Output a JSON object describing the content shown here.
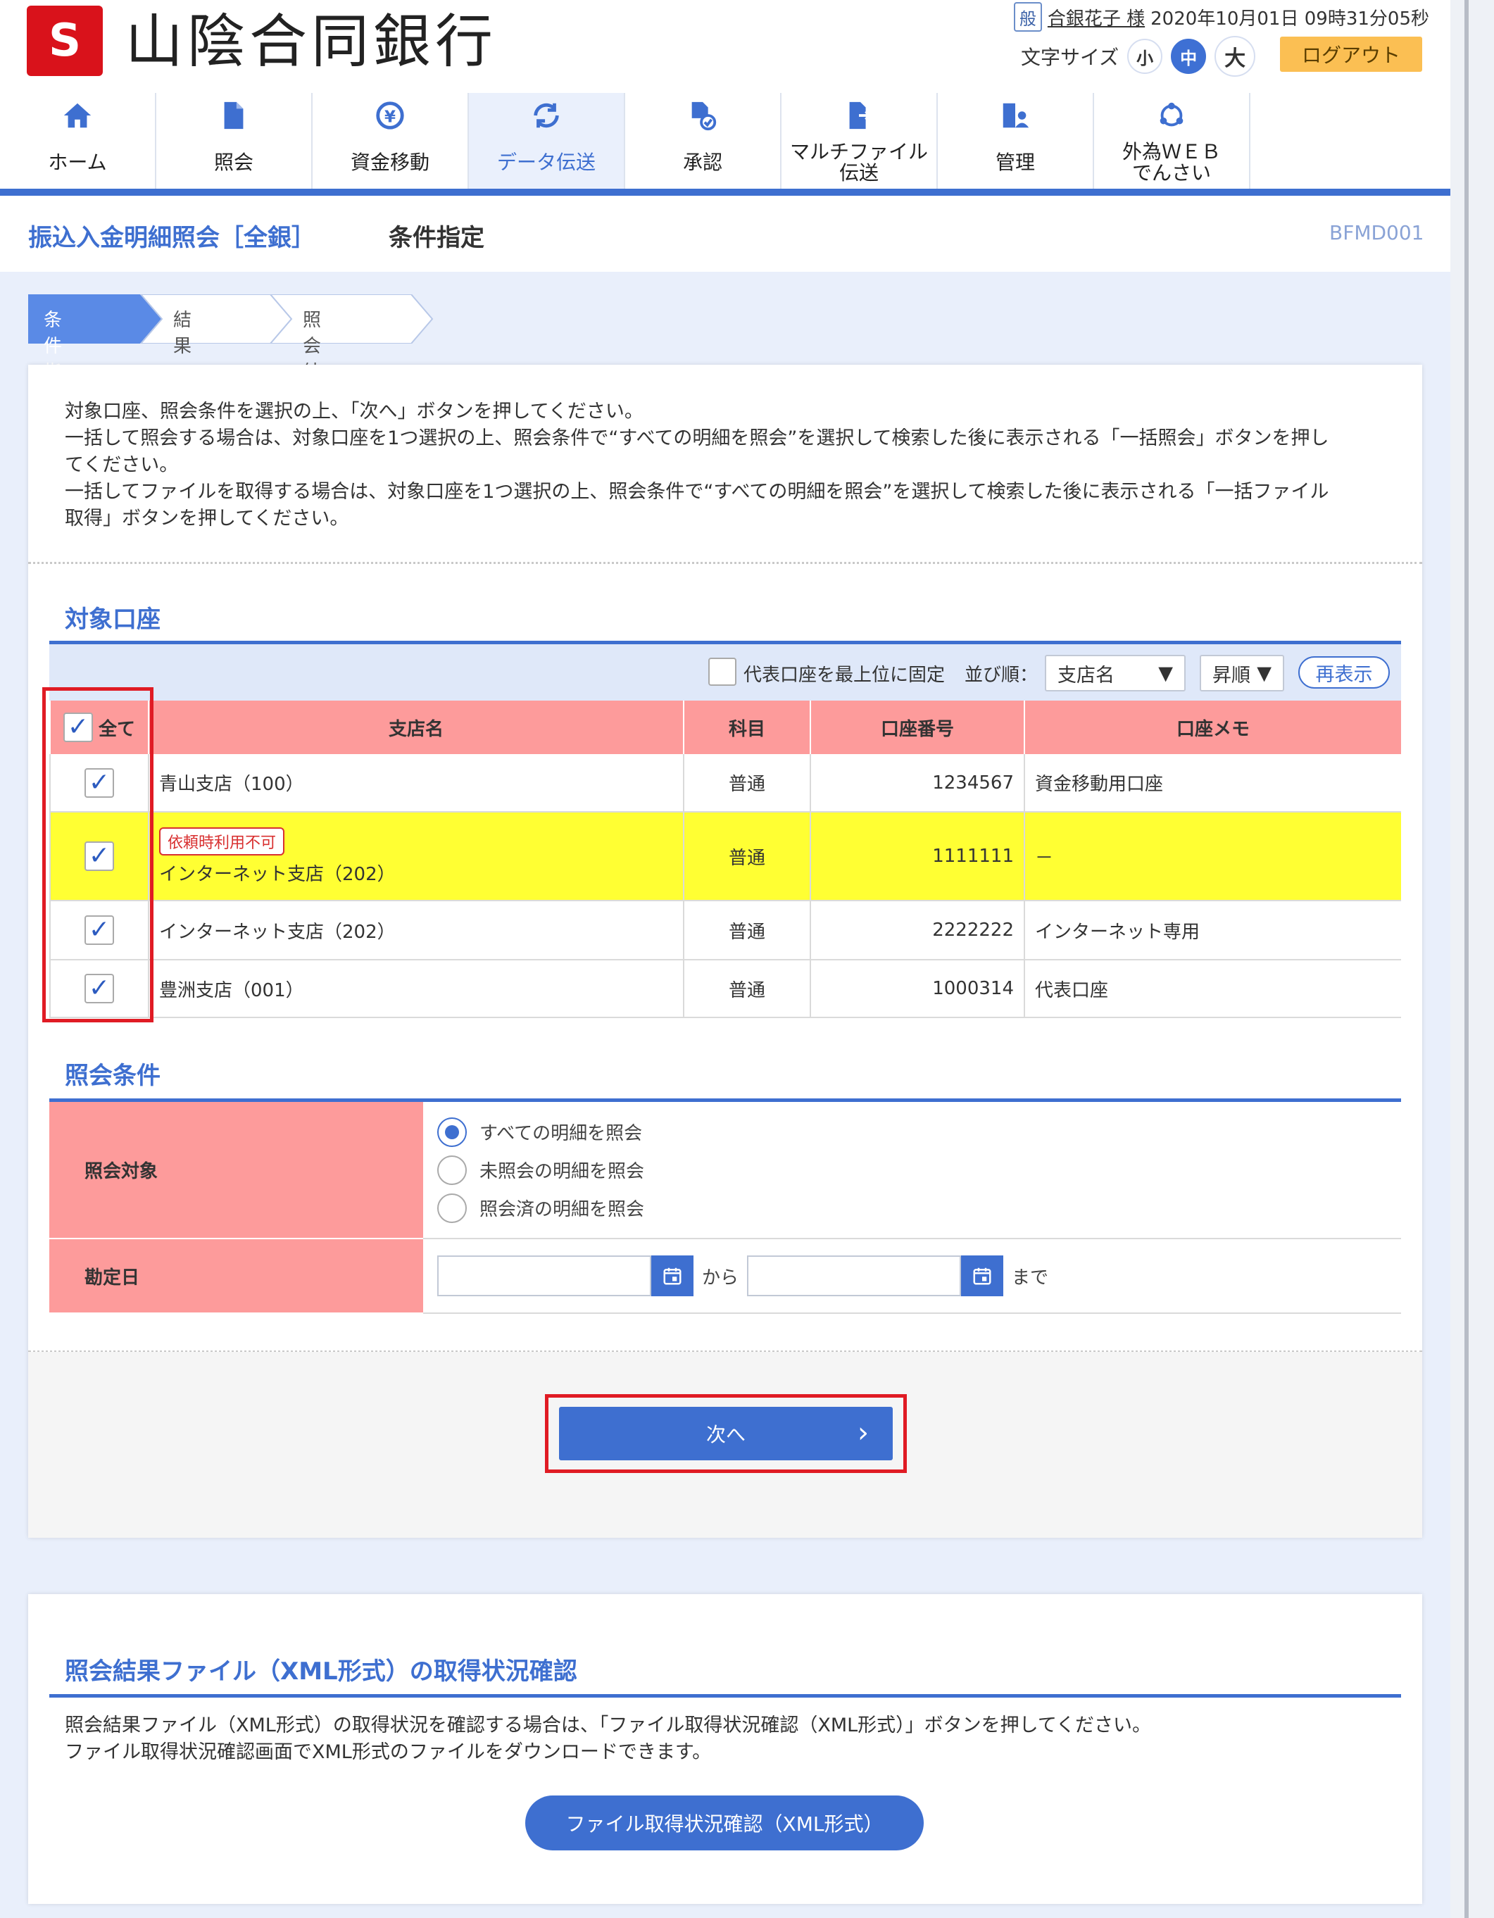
{
  "header": {
    "logo_text": "S",
    "bank_name": "山陰合同銀行",
    "kind_badge": "般",
    "user_name": "合銀花子 様",
    "login_time": "2020年10月01日 09時31分05秒",
    "font_size_label": "文字サイズ",
    "font_small": "小",
    "font_medium": "中",
    "font_large": "大",
    "logout_label": "ログアウト"
  },
  "nav": {
    "items": [
      {
        "label": "ホーム",
        "icon": "home-icon"
      },
      {
        "label": "照会",
        "icon": "document-icon"
      },
      {
        "label": "資金移動",
        "icon": "yen-transfer-icon"
      },
      {
        "label": "データ伝送",
        "icon": "refresh-icon"
      },
      {
        "label": "承認",
        "icon": "approve-document-icon"
      },
      {
        "label": "マルチファイル\n伝送",
        "icon": "file-transfer-icon"
      },
      {
        "label": "管理",
        "icon": "building-user-icon"
      },
      {
        "label": "外為ＷＥＢ\nでんさい",
        "icon": "network-icon"
      }
    ],
    "active_index": 3
  },
  "page": {
    "title": "振込入金明細照会［全銀］",
    "subtitle": "条件指定",
    "screen_id": "BFMD001"
  },
  "steps": [
    "条件指定",
    "結果一覧",
    "照会結果"
  ],
  "instructions": [
    "対象口座、照会条件を選択の上、「次へ」ボタンを押してください。",
    "一括して照会する場合は、対象口座を1つ選択の上、照会条件で“すべての明細を照会”を選択して検索した後に表示される「一括照会」ボタンを押し",
    "てください。",
    "一括してファイルを取得する場合は、対象口座を1つ選択の上、照会条件で“すべての明細を照会”を選択して検索した後に表示される「一括ファイル",
    "取得」ボタンを押してください。"
  ],
  "account_section": {
    "title": "対象口座",
    "pin_label": "代表口座を最上位に固定",
    "sort_label": "並び順：",
    "sort_value": "支店名",
    "order_value": "昇順",
    "redisplay_label": "再表示",
    "headers": {
      "all": "全て",
      "branch": "支店名",
      "subject": "科目",
      "number": "口座番号",
      "memo": "口座メモ"
    },
    "rows": [
      {
        "checked": true,
        "tag": "",
        "branch": "青山支店（100）",
        "subject": "普通",
        "number": "1234567",
        "memo": "資金移動用口座"
      },
      {
        "checked": true,
        "tag": "依頼時利用不可",
        "branch": "インターネット支店（202）",
        "subject": "普通",
        "number": "1111111",
        "memo": "－"
      },
      {
        "checked": true,
        "tag": "",
        "branch": "インターネット支店（202）",
        "subject": "普通",
        "number": "2222222",
        "memo": "インターネット専用"
      },
      {
        "checked": true,
        "tag": "",
        "branch": "豊洲支店（001）",
        "subject": "普通",
        "number": "1000314",
        "memo": "代表口座"
      }
    ]
  },
  "condition_section": {
    "title": "照会条件",
    "target_label": "照会対象",
    "options": [
      "すべての明細を照会",
      "未照会の明細を照会",
      "照会済の明細を照会"
    ],
    "selected_index": 0,
    "date_label": "勘定日",
    "from_label": "から",
    "to_label": "まで"
  },
  "next_label": "次へ",
  "file_section": {
    "title": "照会結果ファイル（XML形式）の取得状況確認",
    "desc": [
      "照会結果ファイル（XML形式）の取得状況を確認する場合は、「ファイル取得状況確認（XML形式）」ボタンを押してください。",
      "ファイル取得状況確認画面でXML形式のファイルをダウンロードできます。"
    ],
    "button_label": "ファイル取得状況確認（XML形式）"
  },
  "colors": {
    "accent": "#3e6fd0",
    "header_pink": "#fd9b9b",
    "highlight": "#ffff33",
    "alert_red": "#e01b24"
  }
}
